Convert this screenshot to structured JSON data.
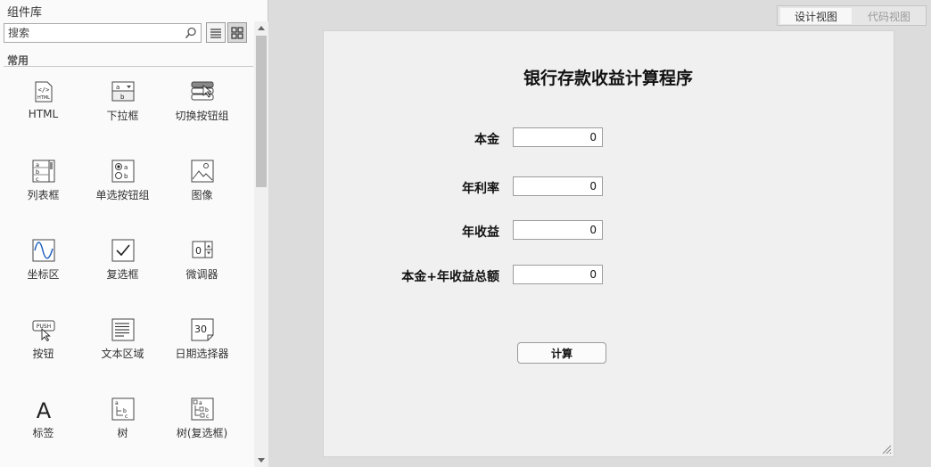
{
  "library": {
    "title": "组件库",
    "search_placeholder": "搜索",
    "section": "常用",
    "items": [
      {
        "label": "HTML",
        "icon": "html-icon"
      },
      {
        "label": "下拉框",
        "icon": "dropdown-icon"
      },
      {
        "label": "切换按钮组",
        "icon": "toggle-button-group-icon"
      },
      {
        "label": "列表框",
        "icon": "listbox-icon"
      },
      {
        "label": "单选按钮组",
        "icon": "radio-button-group-icon"
      },
      {
        "label": "图像",
        "icon": "image-icon"
      },
      {
        "label": "坐标区",
        "icon": "axes-icon"
      },
      {
        "label": "复选框",
        "icon": "checkbox-icon"
      },
      {
        "label": "微调器",
        "icon": "spinner-icon"
      },
      {
        "label": "按钮",
        "icon": "push-button-icon"
      },
      {
        "label": "文本区域",
        "icon": "text-area-icon"
      },
      {
        "label": "日期选择器",
        "icon": "date-picker-icon"
      },
      {
        "label": "标签",
        "icon": "label-icon"
      },
      {
        "label": "树",
        "icon": "tree-icon"
      },
      {
        "label": "树(复选框)",
        "icon": "tree-checkbox-icon"
      }
    ]
  },
  "view_tabs": {
    "design": "设计视图",
    "code": "代码视图"
  },
  "app": {
    "title": "银行存款收益计算程序",
    "fields": [
      {
        "label": "本金",
        "value": "0"
      },
      {
        "label": "年利率",
        "value": "0"
      },
      {
        "label": "年收益",
        "value": "0"
      },
      {
        "label": "本金+年收益总额",
        "value": "0"
      }
    ],
    "button": "计算"
  }
}
